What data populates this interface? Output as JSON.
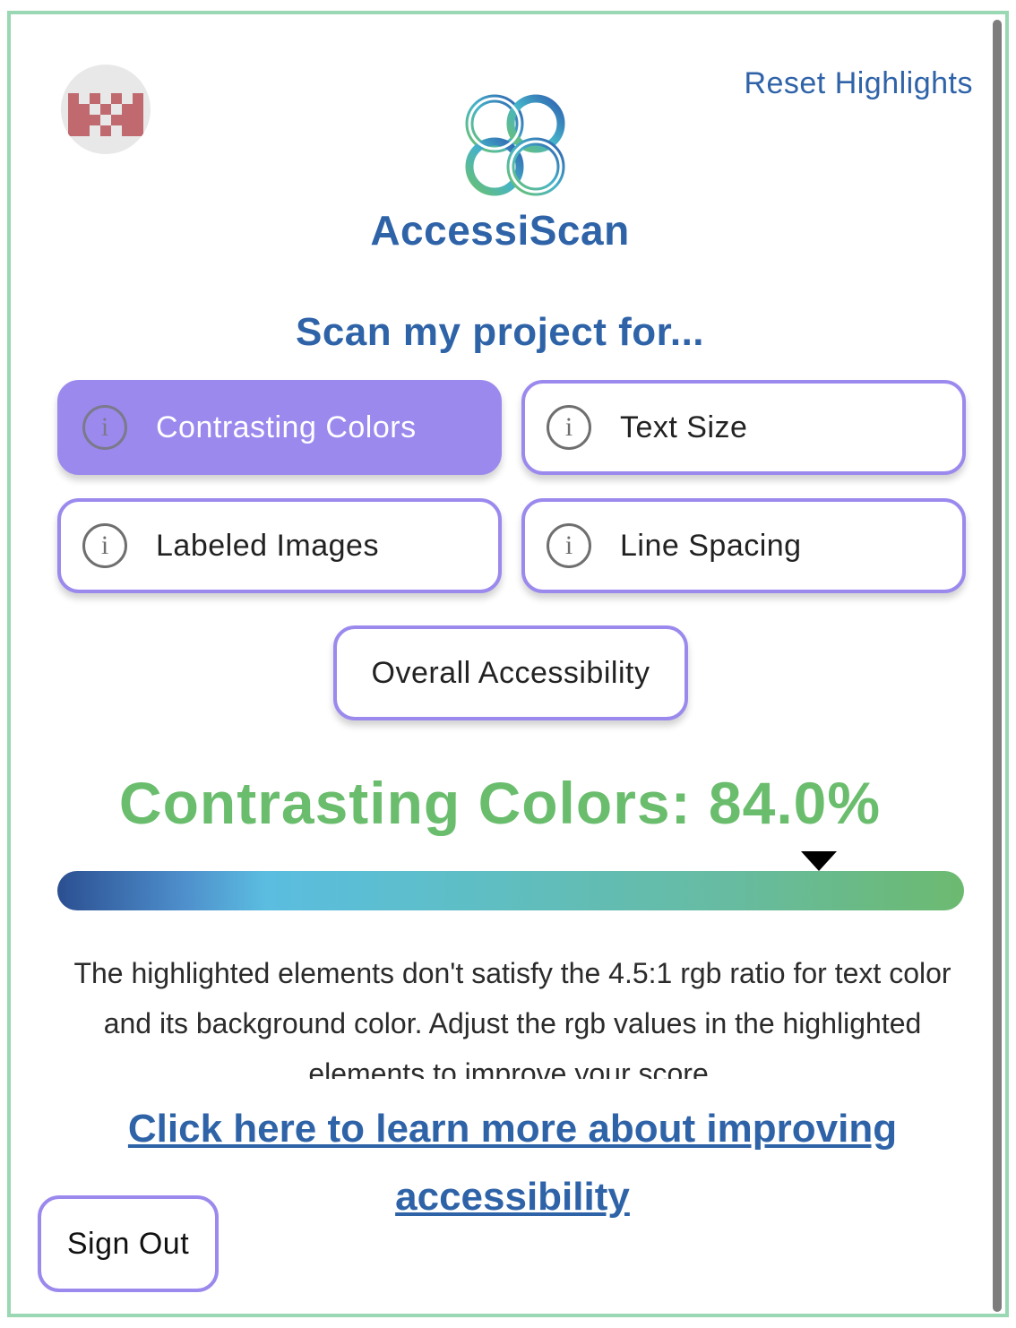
{
  "header": {
    "reset_label": "Reset Highlights",
    "brand_name": "AccessiScan",
    "avatar_icon": "pixel-avatar-icon",
    "logo_icon": "accessiscan-logo-icon"
  },
  "scan": {
    "title": "Scan my project for...",
    "options": [
      {
        "label": "Contrasting Colors",
        "icon": "info-icon",
        "selected": true
      },
      {
        "label": "Text Size",
        "icon": "info-icon",
        "selected": false
      },
      {
        "label": "Labeled Images",
        "icon": "info-icon",
        "selected": false
      },
      {
        "label": "Line Spacing",
        "icon": "info-icon",
        "selected": false
      }
    ],
    "overall_label": "Overall Accessibility"
  },
  "result": {
    "score_text": "Contrasting Colors: 84.0%",
    "score_value": 84.0,
    "description": "The highlighted elements don't satisfy the 4.5:1 rgb ratio for text color and its background color. Adjust the rgb values in the highlighted elements to improve your score.",
    "learn_more": "Click here to learn more about improving accessibility"
  },
  "footer": {
    "sign_out_label": "Sign Out"
  },
  "colors": {
    "accent_purple": "#9b89ee",
    "brand_blue": "#2f63a8",
    "score_green": "#6bbd6e",
    "frame_green": "#9ad7b3"
  }
}
